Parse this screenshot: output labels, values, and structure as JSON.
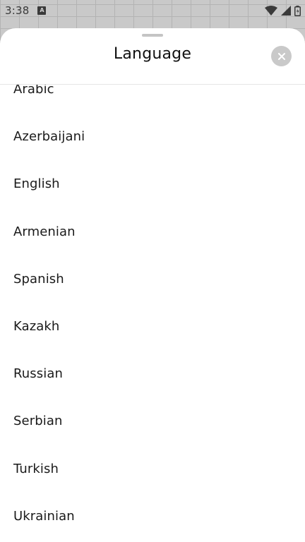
{
  "status_bar": {
    "time": "3:38",
    "notification_icon": "a-keyboard-icon",
    "icons": [
      "wifi-icon",
      "signal-icon",
      "battery-icon"
    ]
  },
  "sheet": {
    "title": "Language",
    "close_icon": "close-icon",
    "languages": [
      "Arabic",
      "Azerbaijani",
      "English",
      "Armenian",
      "Spanish",
      "Kazakh",
      "Russian",
      "Serbian",
      "Turkish",
      "Ukrainian"
    ]
  }
}
